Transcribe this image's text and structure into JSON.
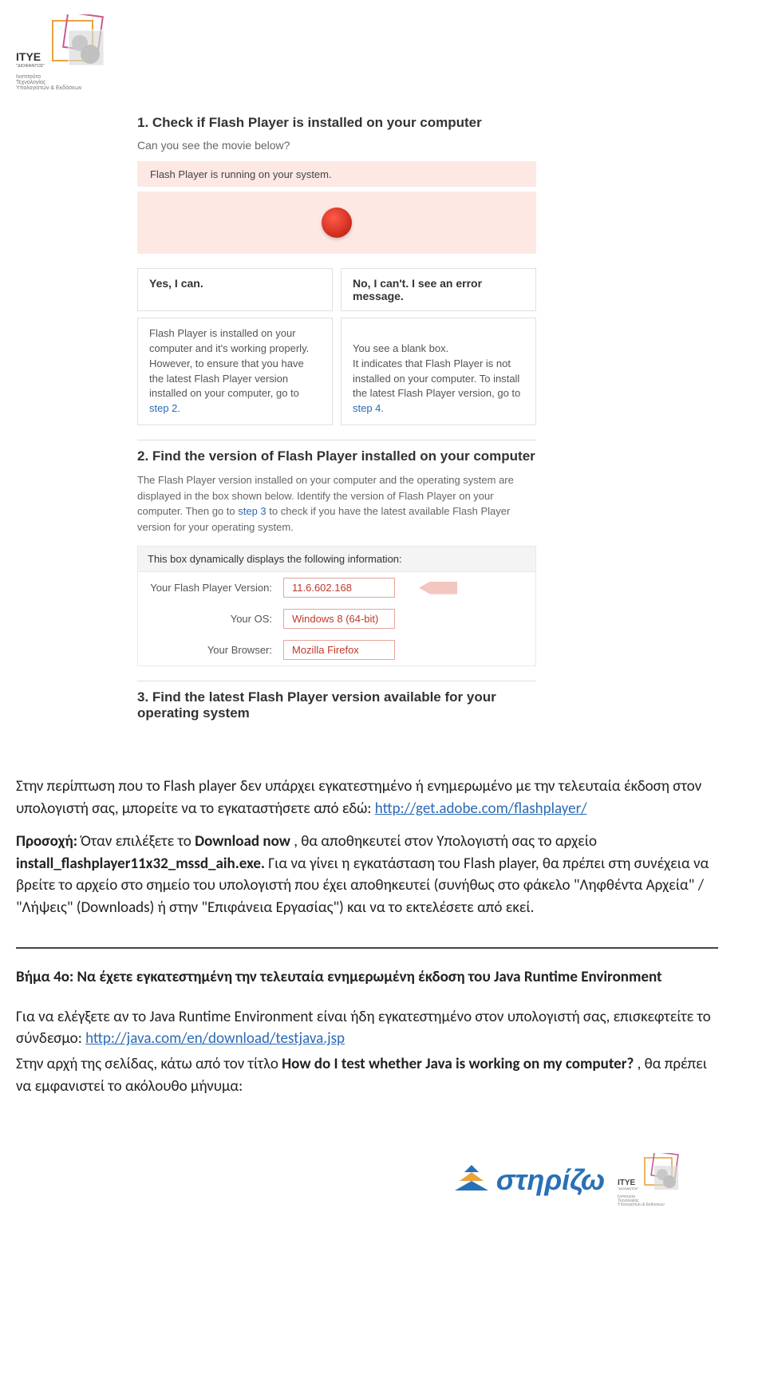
{
  "header": {
    "org_lines": [
      "Ινστιτούτο",
      "Τεχνολογίας",
      "Υπολογιστών & Εκδόσεων"
    ],
    "org_name": "\"ΔΙΟΦΑΝΤΟΣ\""
  },
  "section1": {
    "heading": "1. Check if Flash Player is installed on your computer",
    "subtext": "Can you see the movie below?",
    "flash_running": "Flash Player is running on your system.",
    "yes_head": "Yes, I can.",
    "no_head": "No, I can't. I see an error message.",
    "yes_body_pre": "Flash Player is installed on your computer and it's working properly. However, to ensure that you have the latest Flash Player version installed on your computer, go to ",
    "yes_link": "step 2.",
    "no_body_pre": "You see a blank box.\nIt indicates that Flash Player is not installed on your computer. To install the latest Flash Player version, go to ",
    "no_link": "step 4."
  },
  "section2": {
    "heading": "2. Find the version of Flash Player installed on your computer",
    "desc_pre": "The Flash Player version installed on your computer and the operating system are displayed in the box shown below. Identify the version of Flash Player on your computer. Then go to ",
    "desc_link": "step 3",
    "desc_post": " to check if you have the latest available Flash Player version for your operating system.",
    "box_head": "This box dynamically displays the following information:",
    "rows": [
      {
        "label": "Your Flash Player Version:",
        "value": "11.6.602.168"
      },
      {
        "label": "Your OS:",
        "value": "Windows 8 (64-bit)"
      },
      {
        "label": "Your Browser:",
        "value": "Mozilla Firefox"
      }
    ]
  },
  "section3": {
    "heading": "3. Find the latest Flash Player version available for your operating system"
  },
  "greek": {
    "p1_a": "Στην περίπτωση που το Flash player δεν υπάρχει εγκατεστημένο ή ενημερωμένο με την τελευταία έκδοση στον υπολογιστή σας, μπορείτε να το εγκαταστήσετε από εδώ: ",
    "p1_link": "http://get.adobe.com/flashplayer/",
    "p2_prefix": "Προσοχή:",
    "p2_a": " Όταν επιλέξετε το ",
    "p2_b_bold": "Download now",
    "p2_c": ", θα αποθηκευτεί στον Υπολογιστή σας το αρχείο ",
    "p2_d_bold": "install_flashplayer11x32_mssd_aih.exe.",
    "p2_e": " Για να γίνει η εγκατάσταση του Flash player, θα πρέπει στη συνέχεια να βρείτε το αρχείο στο σημείο του υπολογιστή που έχει αποθηκευτεί (συνήθως στο φάκελο \"Ληφθέντα Αρχεία\" / \"Λήψεις\" (Downloads) ή στην \"Επιφάνεια Εργασίας\") και να το εκτελέσετε από εκεί.",
    "step4_heading": "Βήμα 4ο:  Να έχετε εγκατεστημένη την τελευταία ενημερωμένη έκδοση του Java Runtime Environment",
    "p3_a": "Για να ελέγξετε αν το Java Runtime Environment είναι ήδη εγκατεστημένο στον υπολογιστή σας, επισκεφτείτε το σύνδεσμο: ",
    "p3_link": "http://java.com/en/download/testjava.jsp",
    "p4_a": "Στην αρχή της σελίδας, κάτω από τον τίτλο ",
    "p4_b_bold": "How do I test whether Java is working on my computer?",
    "p4_c": ", θα πρέπει να εμφανιστεί το ακόλουθο μήνυμα:"
  },
  "footer": {
    "stirizo": "στηρίζω"
  }
}
